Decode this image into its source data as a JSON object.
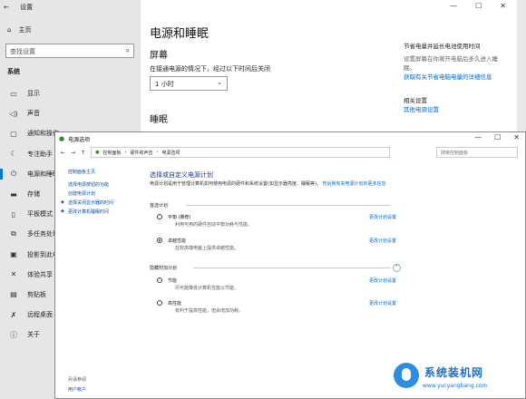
{
  "settings": {
    "window_title": "设置",
    "home": "主页",
    "search_placeholder": "查找设置",
    "section": "系统",
    "nav": [
      {
        "label": "显示",
        "icon": "display-icon"
      },
      {
        "label": "声音",
        "icon": "speaker-icon"
      },
      {
        "label": "通知和操作",
        "icon": "notification-icon"
      },
      {
        "label": "专注助手",
        "icon": "moon-icon"
      },
      {
        "label": "电源和睡眠",
        "icon": "power-icon"
      },
      {
        "label": "存储",
        "icon": "storage-icon"
      },
      {
        "label": "平板模式",
        "icon": "tablet-icon"
      },
      {
        "label": "多任务处理",
        "icon": "multitask-icon"
      },
      {
        "label": "投影到此电脑",
        "icon": "projector-icon"
      },
      {
        "label": "体验共享",
        "icon": "share-icon"
      },
      {
        "label": "剪贴板",
        "icon": "clipboard-icon"
      },
      {
        "label": "远程桌面",
        "icon": "remote-icon"
      },
      {
        "label": "关于",
        "icon": "info-icon"
      }
    ],
    "page_title": "电源和睡眠",
    "screen_heading": "屏幕",
    "screen_desc": "在接通电源的情况下，经过以下时间后关闭",
    "screen_value": "1 小时",
    "sleep_heading": "睡眠",
    "right": {
      "tip_title": "节省电量并延长电池使用时间",
      "tip_desc_1": "设置屏幕在你离开电脑后多久进入睡",
      "tip_desc_2": "眠。",
      "tip_link": "获取有关节省电脑电量的详细信息",
      "related_title": "相关设置",
      "related_link": "其他电源设置"
    }
  },
  "cp": {
    "title": "电源选项",
    "breadcrumbs": [
      "控制面板",
      "硬件和声音",
      "电源选项"
    ],
    "search_placeholder": "搜索控制面板",
    "side": {
      "home": "控制面板主页",
      "items": [
        "选择电源按钮的功能",
        "创建电源计划",
        "选择关闭显示器的时间",
        "更改计算机睡眠时间"
      ],
      "see_also": "另请参阅",
      "user_accounts": "用户帐户"
    },
    "heading": "选择或自定义电源计划",
    "intro": "电源计划是用于管理计算机如何使用电源的硬件和系统设置(如显示器亮度、睡眠等)。",
    "intro_link": "告诉我有关电源计划的更多信息",
    "preferred": "首选计划",
    "hidden": "隐藏附加计划",
    "change_link": "更改计划设置",
    "plans": [
      {
        "name": "平衡 (推荐)",
        "desc": "利用可用的硬件自动平衡功耗与性能。",
        "selected": false
      },
      {
        "name": "卓越性能",
        "desc": "在较高端电脑上提供卓越性能。",
        "selected": true
      },
      {
        "name": "节能",
        "desc": "尽可能降低计算机性能以节能。",
        "selected": false
      },
      {
        "name": "高性能",
        "desc": "有利于提高性能，但会增加功耗。",
        "selected": false
      }
    ]
  },
  "watermark": {
    "title": "系统装机网",
    "url": "www.yucyangbang.com"
  }
}
